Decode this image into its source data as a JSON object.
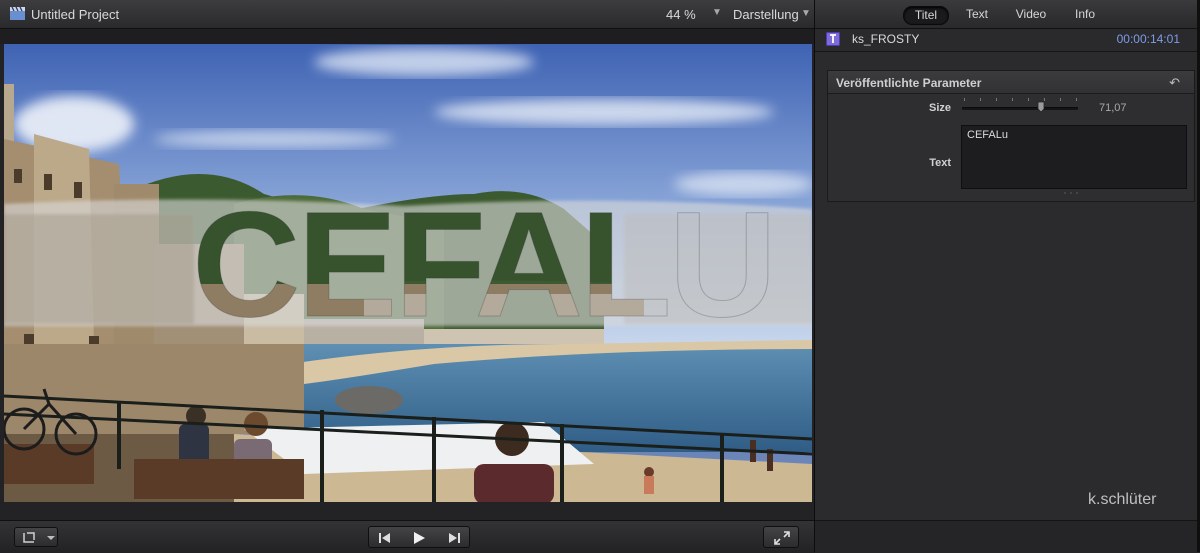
{
  "viewer": {
    "project_title": "Untitled Project",
    "zoom": "44 %",
    "display_menu": "Darstellung",
    "canvas_title_text": "CEFALU"
  },
  "inspector": {
    "tabs": [
      {
        "label": "Titel",
        "active": true
      },
      {
        "label": "Text",
        "active": false
      },
      {
        "label": "Video",
        "active": false
      },
      {
        "label": "Info",
        "active": false
      }
    ],
    "clip_name": "ks_FROSTY",
    "timecode": "00:00:14:01",
    "params_header": "Veröffentlichte Parameter",
    "size_label": "Size",
    "size_value": "71,07",
    "size_fraction": 0.68,
    "text_label": "Text",
    "text_value": "CEFALu"
  },
  "watermark": "k.schlüter",
  "colors": {
    "accent_timecode": "#7d9ce8",
    "title_icon": "#7d6cd6",
    "panel_bg": "#2b2b2e"
  },
  "icons": {
    "project": "clapperboard-icon",
    "transform": "crop-transform-icon",
    "go_to_start": "skip-to-start-icon",
    "play": "play-icon",
    "go_to_end": "skip-to-end-icon",
    "fullscreen": "fullscreen-icon",
    "reset": "reset-arrow-icon"
  }
}
